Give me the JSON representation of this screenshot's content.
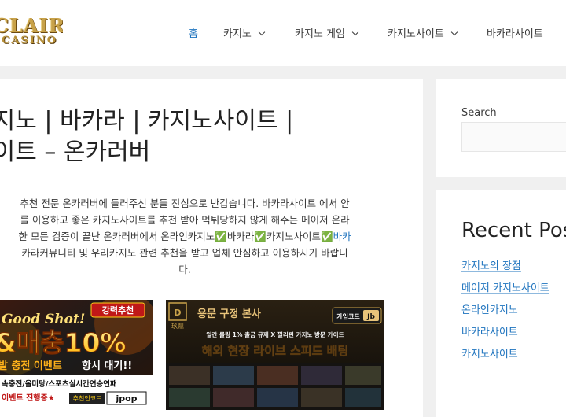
{
  "header": {
    "logo_text": "CLAIRE",
    "logo_sub": "CASINO",
    "nav": [
      {
        "label": "홈",
        "active": true,
        "has_dropdown": false
      },
      {
        "label": "카지노",
        "active": false,
        "has_dropdown": true
      },
      {
        "label": "카지노 게임",
        "active": false,
        "has_dropdown": true
      },
      {
        "label": "카지노사이트",
        "active": false,
        "has_dropdown": true
      },
      {
        "label": "바카라사이트",
        "active": false,
        "has_dropdown": false
      }
    ]
  },
  "main": {
    "title_line1": "카지노 | 바카라 | 카지노사이트 |",
    "title_line2": "사이트 – 온카러버",
    "intro": {
      "line1": "추천 전문 온카러버에 들러주신 분들 진심으로 반갑습니다. 바카라사이트 에서 안",
      "line2": "를 이용하고 좋은 카지노사이트를 추천 받아 먹튀당하지 않게 해주는 메이저 온라",
      "line3_a": "한 모든 검증이 끝난 온카러버에서 온라인카지노",
      "line3_b": "바카라",
      "line3_c": "카지노사이트",
      "line3_link": "바카",
      "line4": "카라커뮤니티 및 우리카지노 관련 추천을 받고 업체 안심하고 이용하시기 바랍니",
      "line5": "다.",
      "check": "✅"
    },
    "banner1": {
      "badge": "강력추천",
      "headline": "Good Shot!",
      "big": "&매충10%",
      "row1": "발 충전 이벤트",
      "row1b": "항시 대기!!",
      "row2": "속충전/올미당/스포츠실시간연승연패",
      "row3": "이벤트 진행중★",
      "code_label": "추천인코드",
      "code": "jpop"
    },
    "banner2": {
      "brand": "玖鼎",
      "headline": "용문 구정 본사",
      "code_label": "가입코드",
      "code": "Jb",
      "sub": "일간 롤링 1% 출금 규제 X 필리핀 카지노 방문 가이드",
      "big": "해외 현장 라이브 스피드 배팅"
    }
  },
  "sidebar": {
    "search_label": "Search",
    "recent_title": "Recent Pos",
    "recent": [
      "카지노의 장점",
      "메이저 카지노사이트",
      "온라인카지노",
      "바카라사이트",
      "카지노사이트"
    ]
  },
  "colors": {
    "link": "#1e73be",
    "text": "#222222",
    "page_bg": "#f0f0f0",
    "banner_yellow": "#ffd21a",
    "banner_orange": "#ff8c1a"
  }
}
